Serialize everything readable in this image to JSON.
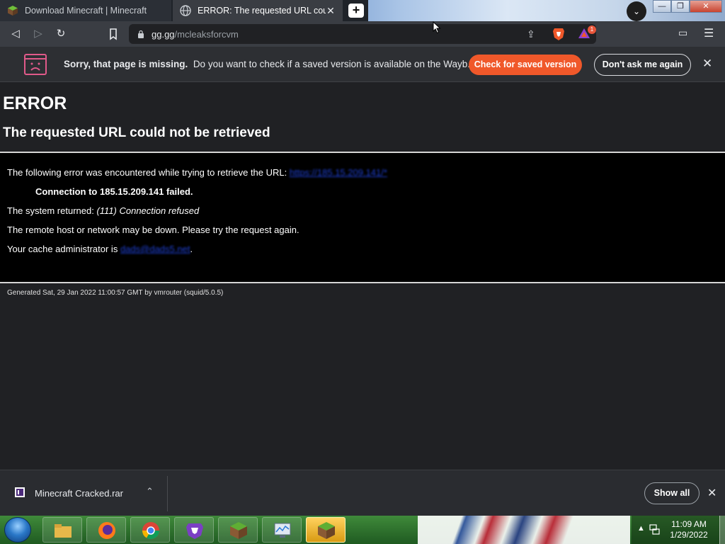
{
  "tabs": [
    {
      "title": "Download Minecraft | Minecraft",
      "active": false
    },
    {
      "title": "ERROR: The requested URL could",
      "active": true
    }
  ],
  "window_controls": {
    "minimize": "—",
    "restore": "❐",
    "close": "✕"
  },
  "address_bar": {
    "host": "gg.gg",
    "path": "/mcleaksforcvm"
  },
  "rewards_badge": "1",
  "infobar": {
    "title": "Sorry, that page is missing.",
    "message": "Do you want to check if a saved version is available on the Wayb...",
    "primary_button": "Check for saved version",
    "secondary_button": "Don't ask me again"
  },
  "page": {
    "heading": "ERROR",
    "subheading": "The requested URL could not be retrieved",
    "line1_text": "The following error was encountered while trying to retrieve the URL:",
    "line1_link": "https://185.15.209.141/*",
    "connection_line": "Connection to 185.15.209.141 failed.",
    "system_returned_label": "The system returned:",
    "system_returned_value": "(111) Connection refused",
    "remote_line": "The remote host or network may be down. Please try the request again.",
    "admin_label": "Your cache administrator is",
    "admin_link": "dads@dads5.net",
    "admin_suffix": ".",
    "footer": "Generated Sat, 29 Jan 2022 11:00:57 GMT by vmrouter (squid/5.0.5)"
  },
  "downloads": {
    "file_name": "Minecraft Cracked.rar",
    "show_all": "Show all"
  },
  "taskbar": {
    "apps": [
      "file-explorer",
      "firefox",
      "chrome",
      "brave",
      "minecraft",
      "performance-monitor",
      "minecraft-launcher"
    ],
    "time": "11:09 AM",
    "date": "1/29/2022"
  },
  "colors": {
    "accent_button": "#f0582a",
    "page_bg": "#202124",
    "error_block_bg": "#000000",
    "link": "#1d3fd1"
  }
}
